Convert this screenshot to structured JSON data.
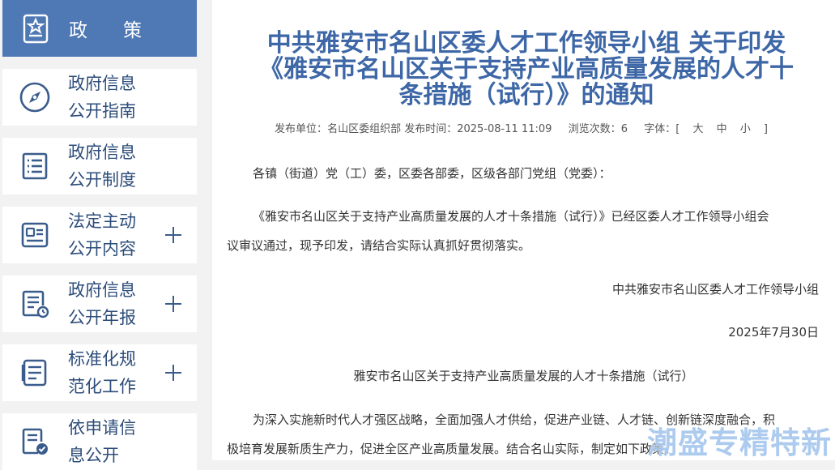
{
  "sidebar": {
    "header_label": "政策",
    "items": [
      {
        "label_line1": "政府信息",
        "label_line2": "公开指南",
        "icon": "compass-icon",
        "expandable": false
      },
      {
        "label_line1": "政府信息",
        "label_line2": "公开制度",
        "icon": "document-list-icon",
        "expandable": false
      },
      {
        "label_line1": "法定主动",
        "label_line2": "公开内容",
        "icon": "id-card-icon",
        "expandable": true
      },
      {
        "label_line1": "政府信息",
        "label_line2": "公开年报",
        "icon": "report-icon",
        "expandable": true
      },
      {
        "label_line1": "标准化规",
        "label_line2": "范化工作",
        "icon": "file-text-icon",
        "expandable": true
      },
      {
        "label_line1": "依申请信",
        "label_line2": "息公开",
        "icon": "doc-check-icon",
        "expandable": false
      }
    ]
  },
  "article": {
    "title_line1": "中共雅安市名山区委人才工作领导小组 关于印发",
    "title_line2": "《雅安市名山区关于支持产业高质量发展的人才十",
    "title_line3": "条措施（试行）》的通知",
    "meta_publisher_label": "发布单位：",
    "meta_publisher": "名山区委组织部",
    "meta_time_label": "发布时间：",
    "meta_time": "2025-08-11 11:09",
    "meta_views_label": "浏览次数：",
    "meta_views": "6",
    "meta_font_label": "字体：",
    "meta_font_options": "[ 大 中 小 ]",
    "salutation": "各镇（街道）党（工）委，区委各部委，区级各部门党组（党委）：",
    "para1_line1": "《雅安市名山区关于支持产业高质量发展的人才十条措施（试行）》已经区委人才工作领导小组会",
    "para1_line2": "议审议通过，现予印发，请结合实际认真抓好贯彻落实。",
    "signature": "中共雅安市名山区委人才工作领导小组",
    "date": "2025年7月30日",
    "subtitle": "雅安市名山区关于支持产业高质量发展的人才十条措施（试行）",
    "para2_line1": "为深入实施新时代人才强区战略，全面加强人才供给，促进产业链、人才链、创新链深度融合，积",
    "para2_line2": "极培育发展新质生产力，促进全区产业高质量发展。结合名山实际，制定如下政策。"
  },
  "watermark": "潮盛专精特新",
  "colors": {
    "accent": "#4f79b5",
    "title": "#3d67a6",
    "label": "#2d4d7a"
  }
}
